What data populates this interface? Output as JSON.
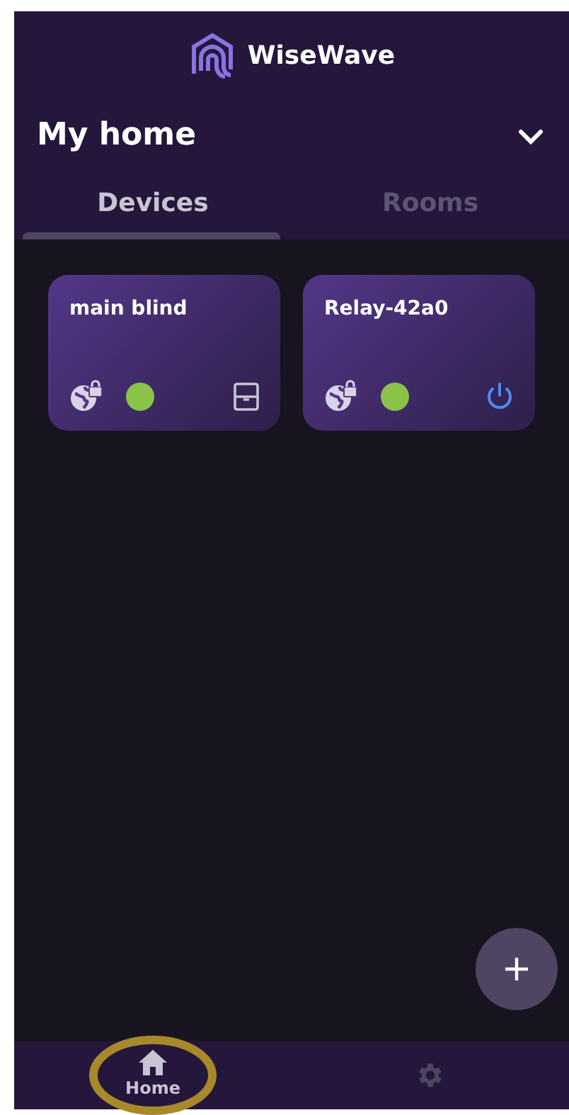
{
  "app": {
    "name": "WiseWave"
  },
  "home": {
    "title": "My home",
    "expanded": false
  },
  "tabs": [
    {
      "label": "Devices",
      "selected": true
    },
    {
      "label": "Rooms",
      "selected": false
    }
  ],
  "devices": [
    {
      "name": "main blind",
      "kind": "blind",
      "color": "#8bc34a"
    },
    {
      "name": "Relay-42a0",
      "kind": "relay",
      "color": "#8bc34a"
    }
  ],
  "nav": [
    {
      "kind": "home",
      "label": "Home",
      "selected": true,
      "highlighted": true
    },
    {
      "kind": "settings",
      "selected": false
    }
  ]
}
